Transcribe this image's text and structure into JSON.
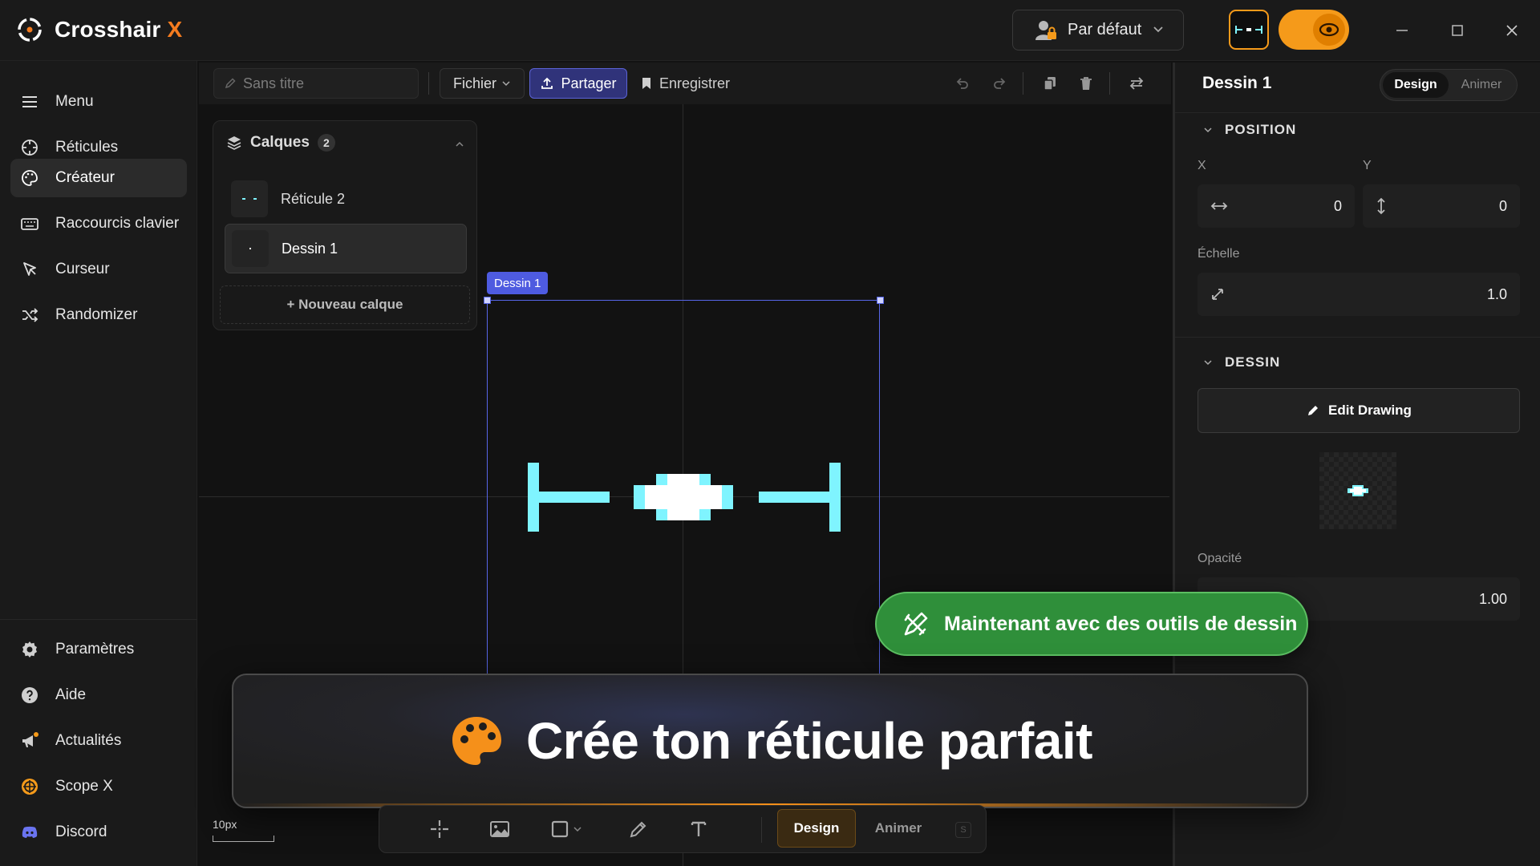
{
  "app": {
    "name": "Crosshair",
    "name_accent": "X",
    "profile": "Par défaut",
    "accent_color": "#f59a1a",
    "crosshair_color": "#7ff4ff"
  },
  "sidebar": {
    "items": [
      {
        "label": "Menu",
        "icon": "menu-icon"
      },
      {
        "label": "Réticules",
        "icon": "crosshair-icon"
      },
      {
        "label": "Créateur",
        "icon": "palette-icon",
        "active": true
      },
      {
        "label": "Raccourcis clavier",
        "icon": "keyboard-icon"
      },
      {
        "label": "Curseur",
        "icon": "cursor-icon"
      },
      {
        "label": "Randomizer",
        "icon": "shuffle-icon"
      }
    ],
    "bottom_items": [
      {
        "label": "Paramètres",
        "icon": "gear-icon"
      },
      {
        "label": "Aide",
        "icon": "help-icon"
      },
      {
        "label": "Actualités",
        "icon": "megaphone-icon"
      },
      {
        "label": "Scope X",
        "icon": "scope-icon"
      },
      {
        "label": "Discord",
        "icon": "discord-icon"
      }
    ]
  },
  "toolbar": {
    "title_placeholder": "Sans titre",
    "file_label": "Fichier",
    "share_label": "Partager",
    "save_label": "Enregistrer"
  },
  "layers": {
    "title": "Calques",
    "count": "2",
    "items": [
      {
        "label": "Réticule 2"
      },
      {
        "label": "Dessin 1",
        "active": true
      }
    ],
    "new_label": "+ Nouveau calque"
  },
  "canvas": {
    "selection_label": "Dessin 1",
    "scale_label": "10px"
  },
  "props": {
    "title": "Dessin 1",
    "mode_design": "Design",
    "mode_animate": "Animer",
    "position_section": "POSITION",
    "x_label": "X",
    "y_label": "Y",
    "x_value": "0",
    "y_value": "0",
    "scale_label": "Échelle",
    "scale_value": "1.0",
    "drawing_section": "DESSIN",
    "edit_drawing_label": "Edit Drawing",
    "opacity_label": "Opacité",
    "opacity_value": "1.00"
  },
  "toast": {
    "text": "Maintenant avec des outils de dessin"
  },
  "banner": {
    "text": "Crée ton réticule parfait"
  },
  "bottom_bar": {
    "design_label": "Design",
    "animate_label": "Animer",
    "key_hint": "S"
  }
}
